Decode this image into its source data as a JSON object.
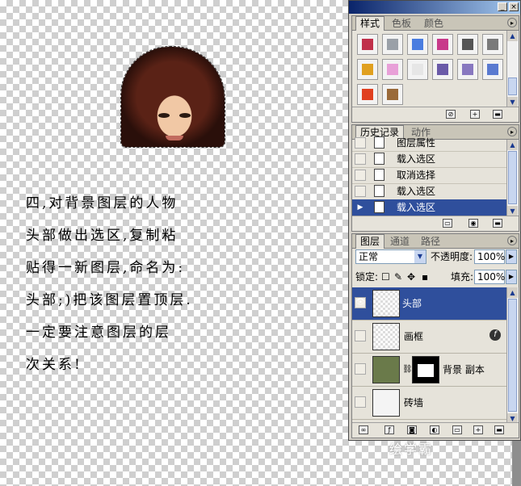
{
  "document_text": {
    "lines": [
      "四,对背景图层的人物",
      "头部做出选区,复制粘",
      "贴得一新图层,命名为:",
      "头部;)把该图层置顶层.",
      "一定要注意图层的层",
      "次关系!"
    ]
  },
  "styles_panel": {
    "tabs": [
      "样式",
      "色板",
      "颜色"
    ],
    "swatches": [
      {
        "icon": "frame-style",
        "color": "#c0304a"
      },
      {
        "icon": "speckle-style",
        "color": "#9aa0a8"
      },
      {
        "icon": "rainbow-style",
        "color": "#4a7de0"
      },
      {
        "icon": "pinwheel-style",
        "color": "#c83a8a"
      },
      {
        "icon": "dark-bevel-style",
        "color": "#555555"
      },
      {
        "icon": "chrome-bevel-style",
        "color": "#7a7a7a"
      },
      {
        "icon": "yellow-frame-style",
        "color": "#e0a020"
      },
      {
        "icon": "pink-style",
        "color": "#e8a0d8"
      },
      {
        "icon": "plain-style",
        "color": "#e6e6e6"
      },
      {
        "icon": "purple-bevel-style",
        "color": "#6a5aa8"
      },
      {
        "icon": "lilac-bevel-style",
        "color": "#8878c0"
      },
      {
        "icon": "blue-glass-style",
        "color": "#5a7ad0"
      },
      {
        "icon": "fire-gradient-style",
        "color": "#e04020"
      },
      {
        "icon": "wood-texture-style",
        "color": "#9a6a3a"
      }
    ]
  },
  "history_panel": {
    "tabs": [
      "历史记录",
      "动作"
    ],
    "items": [
      "图层属性",
      "载入选区",
      "取消选择",
      "载入选区",
      "载入选区"
    ],
    "selected_index": 4
  },
  "layers_panel": {
    "tabs": [
      "图层",
      "通道",
      "路径"
    ],
    "blend_mode": "正常",
    "opacity_label": "不透明度:",
    "opacity_value": "100%",
    "lock_label": "锁定:",
    "fill_label": "填充:",
    "fill_value": "100%",
    "layers": [
      {
        "name": "头部",
        "visible": true,
        "selected": true
      },
      {
        "name": "画框",
        "visible": false,
        "selected": false,
        "has_fx": true
      },
      {
        "name": "背景 副本",
        "visible": false,
        "selected": false,
        "has_mask": true
      },
      {
        "name": "砖墙",
        "visible": false,
        "selected": false
      }
    ]
  },
  "watermark": {
    "text": "绘学霸"
  }
}
